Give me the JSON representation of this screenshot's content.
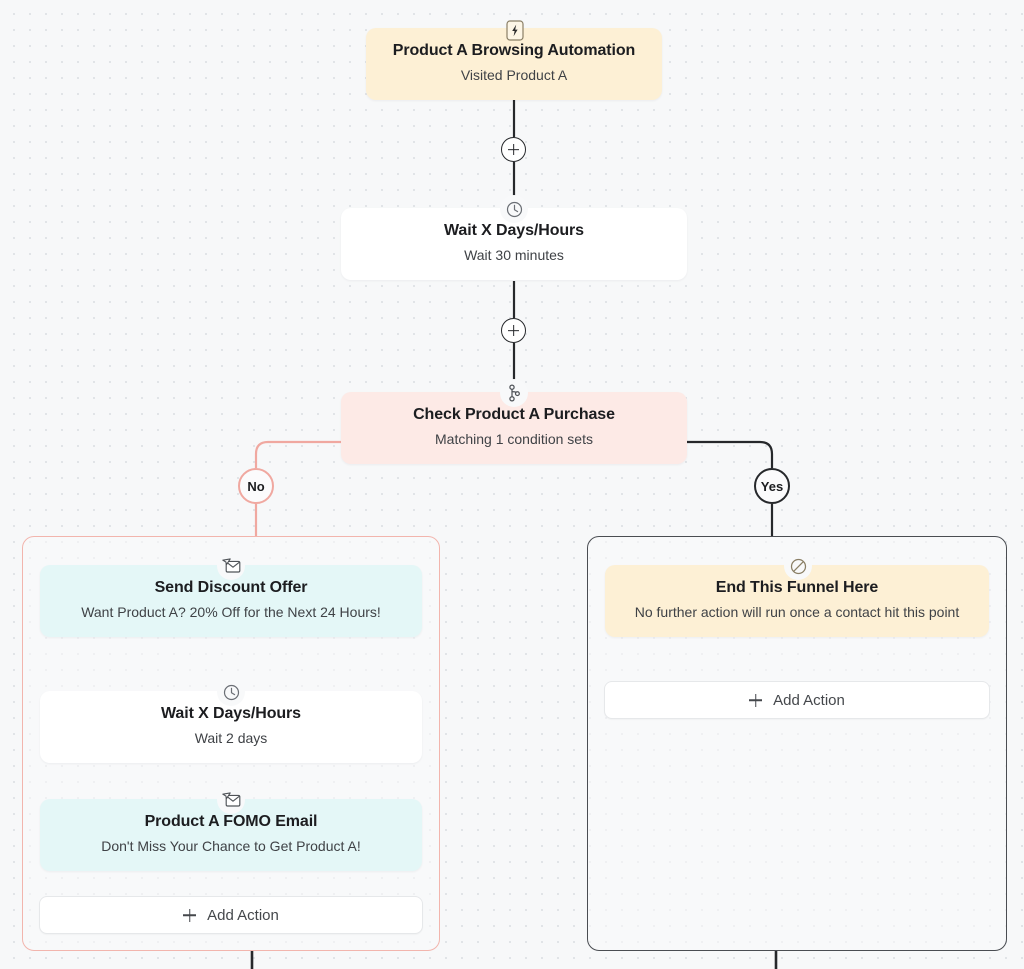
{
  "canvas": {
    "background_color": "#f7f8f9",
    "dot_color": "#dfe2e6"
  },
  "colors": {
    "trigger_bg": "#fdf0d5",
    "wait_bg": "#ffffff",
    "condition_bg": "#fdeae6",
    "email_bg": "#e4f7f7",
    "end_bg": "#fdf0d5",
    "no_branch": "#f0a8a0",
    "yes_branch": "#26282b"
  },
  "nodes": {
    "trigger": {
      "icon": "lightning-bolt-icon",
      "title": "Product A Browsing Automation",
      "subtitle": "Visited Product A"
    },
    "wait_1": {
      "icon": "clock-icon",
      "title": "Wait X Days/Hours",
      "subtitle": "Wait 30 minutes"
    },
    "condition": {
      "icon": "branch-split-icon",
      "title": "Check Product A Purchase",
      "subtitle": "Matching 1 condition sets"
    },
    "discount_email": {
      "icon": "send-email-icon",
      "title": "Send Discount Offer",
      "subtitle": "Want Product A? 20% Off for the Next 24 Hours!"
    },
    "wait_2": {
      "icon": "clock-icon",
      "title": "Wait X Days/Hours",
      "subtitle": "Wait 2 days"
    },
    "fomo_email": {
      "icon": "send-email-icon",
      "title": "Product A FOMO Email",
      "subtitle": "Don't Miss Your Chance to Get Product A!"
    },
    "end_funnel": {
      "icon": "ban-icon",
      "title": "End This Funnel Here",
      "subtitle": "No further action will run once a contact hit this point"
    }
  },
  "branches": {
    "no_label": "No",
    "yes_label": "Yes"
  },
  "buttons": {
    "add_action_left": "Add Action",
    "add_action_right": "Add Action"
  }
}
